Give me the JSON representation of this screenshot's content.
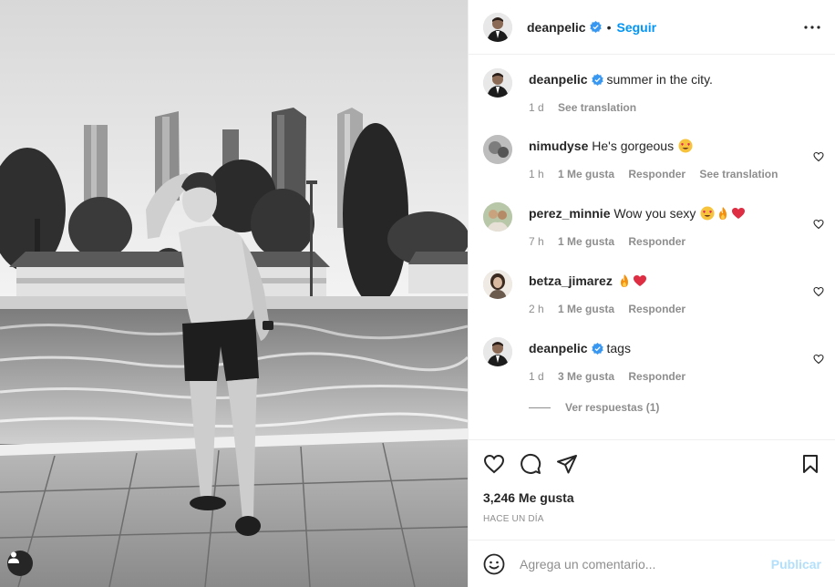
{
  "post": {
    "author": "deanpelic",
    "follow_label": "Seguir",
    "dot": "•",
    "caption_author": "deanpelic",
    "caption": "summer in the city.",
    "caption_time": "1 d",
    "caption_translate": "See translation"
  },
  "comments": [
    {
      "user": "nimudyse",
      "text": "He's gorgeous",
      "emojis": [
        "heart-eyes"
      ],
      "time": "1 h",
      "likes": "1 Me gusta",
      "reply": "Responder",
      "translate": "See translation"
    },
    {
      "user": "perez_minnie",
      "text": "Wow you sexy",
      "emojis": [
        "heart-eyes",
        "fire",
        "red-heart"
      ],
      "time": "7 h",
      "likes": "1 Me gusta",
      "reply": "Responder"
    },
    {
      "user": "betza_jimarez",
      "text": "",
      "emojis": [
        "fire",
        "red-heart"
      ],
      "time": "2 h",
      "likes": "1 Me gusta",
      "reply": "Responder"
    },
    {
      "user": "deanpelic",
      "text": "tags",
      "emojis": [],
      "time": "1 d",
      "likes": "3 Me gusta",
      "reply": "Responder"
    }
  ],
  "view_replies": "Ver respuestas (1)",
  "likes_count": "3,246 Me gusta",
  "posted_ago": "HACE UN DÍA",
  "comment_input": {
    "placeholder": "Agrega un comentario...",
    "value": ""
  },
  "publish_label": "Publicar",
  "colors": {
    "accent": "#0095f6",
    "publish_disabled": "#b2dffc",
    "muted": "#8e8e8e",
    "verified": "#3897f0",
    "like_red": "#ed4956"
  },
  "icons": [
    "verified-badge",
    "more-options-icon",
    "heart-outline-icon",
    "comment-icon",
    "share-icon",
    "save-icon",
    "emoji-icon",
    "user-tag-icon"
  ]
}
